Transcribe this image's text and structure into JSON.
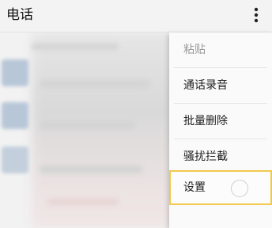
{
  "app_bar": {
    "title": "电话",
    "more_icon": "more-vertical-icon"
  },
  "menu": {
    "items": [
      {
        "label": "粘贴",
        "state": "disabled"
      },
      {
        "label": "通话录音",
        "state": "normal"
      },
      {
        "label": "批量删除",
        "state": "normal"
      },
      {
        "label": "骚扰拦截",
        "state": "normal"
      },
      {
        "label": "设置",
        "state": "highlighted"
      }
    ]
  },
  "colors": {
    "highlight_border": "#f2c94c",
    "menu_background": "#fafafa",
    "app_bar_background": "#f3f3f3"
  }
}
